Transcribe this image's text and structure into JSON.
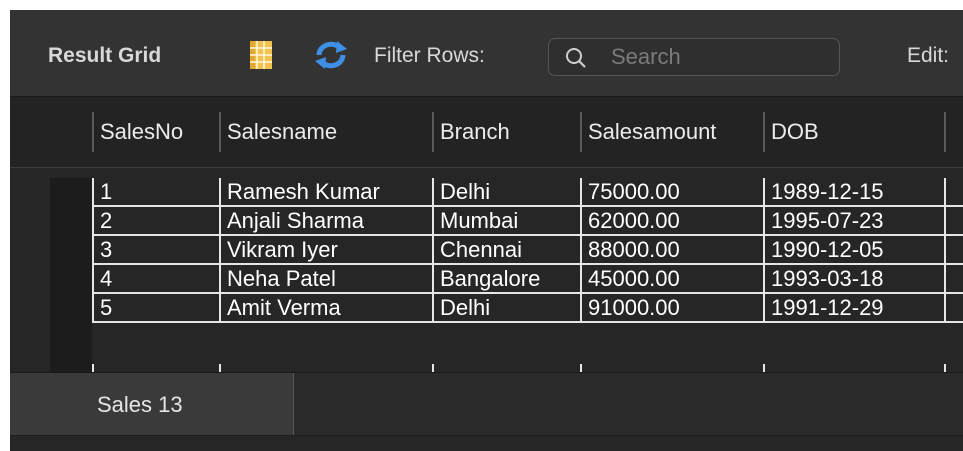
{
  "toolbar": {
    "title": "Result Grid",
    "filter_label": "Filter Rows:",
    "search_placeholder": "Search",
    "edit_label": "Edit:"
  },
  "table": {
    "columns": [
      "SalesNo",
      "Salesname",
      "Branch",
      "Salesamount",
      "DOB"
    ],
    "rows": [
      [
        "1",
        "Ramesh Kumar",
        "Delhi",
        "75000.00",
        "1989-12-15"
      ],
      [
        "2",
        "Anjali Sharma",
        "Mumbai",
        "62000.00",
        "1995-07-23"
      ],
      [
        "3",
        "Vikram Iyer",
        "Chennai",
        "88000.00",
        "1990-12-05"
      ],
      [
        "4",
        "Neha Patel",
        "Bangalore",
        "45000.00",
        "1993-03-18"
      ],
      [
        "5",
        "Amit Verma",
        "Delhi",
        "91000.00",
        "1991-12-29"
      ]
    ]
  },
  "tabs": [
    {
      "label": "Sales 13"
    }
  ],
  "icons": {
    "grid": "grid-view-icon",
    "refresh": "refresh-icon",
    "search": "search-icon"
  },
  "colors": {
    "background": "#2b2b2b",
    "grid_icon": "#e8b53a",
    "refresh_icon": "#3f8fe6"
  }
}
